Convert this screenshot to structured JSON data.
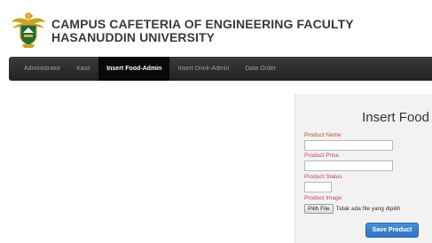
{
  "header": {
    "title_line1": "CAMPUS CAFETERIA OF ENGINEERING FACULTY",
    "title_line2": "HASANUDDIN UNIVERSITY",
    "logo_icon": "university-crest-icon"
  },
  "nav": {
    "items": [
      {
        "label": "Administrator"
      },
      {
        "label": "Kasir"
      },
      {
        "label": "Insert Food-Admin",
        "active": true
      },
      {
        "label": "Insert Drink-Admin"
      },
      {
        "label": "Data Order"
      }
    ]
  },
  "form": {
    "title": "Insert Food",
    "product_name_label": "Product Name",
    "product_name_value": "",
    "product_price_label": "Product Price",
    "product_price_value": "",
    "product_status_label": "Product Status",
    "product_status_value": "",
    "product_image_label": "Product Image",
    "file_button_label": "Pilih File",
    "file_status_text": "Tidak ada file yang dipilih",
    "submit_label": "Save Product"
  },
  "colors": {
    "navbar": "#222222",
    "nav_active": "#080808",
    "label_red": "#b94a48",
    "button_blue": "#3a82cc",
    "panel_bg": "#f2f2f2"
  }
}
